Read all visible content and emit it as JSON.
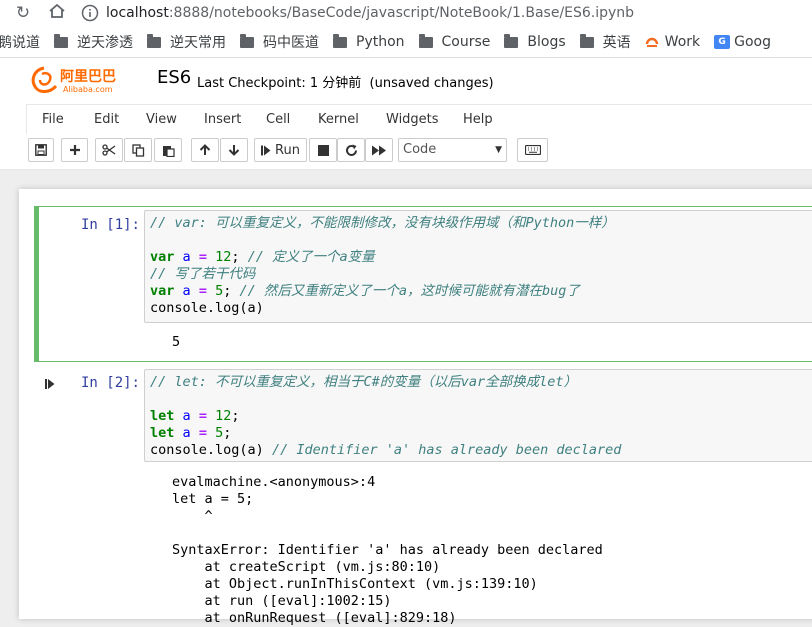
{
  "browser": {
    "url_host": "localhost",
    "url_rest": ":8888/notebooks/BaseCode/javascript/NoteBook/1.Base/ES6.ipynb",
    "back_icon": "arrow-left-icon",
    "reload_icon": "reload-icon",
    "home_icon": "home-icon"
  },
  "bookmarks": [
    {
      "label": "鹅说道",
      "icon": "none"
    },
    {
      "label": "逆天渗透",
      "icon": "folder-icon"
    },
    {
      "label": "逆天常用",
      "icon": "folder-icon"
    },
    {
      "label": "码中医道",
      "icon": "folder-icon"
    },
    {
      "label": "Python",
      "icon": "folder-icon"
    },
    {
      "label": "Course",
      "icon": "folder-icon"
    },
    {
      "label": "Blogs",
      "icon": "folder-icon"
    },
    {
      "label": "英语",
      "icon": "folder-icon"
    },
    {
      "label": "Work",
      "icon": "work-icon"
    },
    {
      "label": "Goog",
      "icon": "google-translate-icon"
    }
  ],
  "header": {
    "logo_text": "阿里巴巴",
    "logo_sub": "Alibaba.com",
    "notebook_title": "ES6",
    "checkpoint": "Last Checkpoint: 1 分钟前",
    "unsaved": "(unsaved changes)"
  },
  "menu": [
    "File",
    "Edit",
    "View",
    "Insert",
    "Cell",
    "Kernel",
    "Widgets",
    "Help"
  ],
  "toolbar": {
    "run_label": "Run",
    "cell_type": "Code"
  },
  "cells": [
    {
      "prompt": "In [1]:",
      "output": [
        "5"
      ]
    },
    {
      "prompt": "In [2]:",
      "output": [
        "evalmachine.<anonymous>:4",
        "let a = 5;",
        "    ^",
        "",
        "SyntaxError: Identifier 'a' has already been declared",
        "    at createScript (vm.js:80:10)",
        "    at Object.runInThisContext (vm.js:139:10)",
        "    at run ([eval]:1002:15)",
        "    at onRunRequest ([eval]:829:18)"
      ]
    }
  ],
  "code": {
    "c1_l1": "// var: 可以重复定义，不能限制修改，没有块级作用域（和Python一样）",
    "c1_l3_kw": "var",
    "c1_l3_var": "a",
    "c1_l3_op": "=",
    "c1_l3_num": "12",
    "c1_l3_com": "// 定义了一个a变量",
    "c1_l4": "// 写了若干代码",
    "c1_l5_kw": "var",
    "c1_l5_var": "a",
    "c1_l5_op": "=",
    "c1_l5_num": "5",
    "c1_l5_com": "// 然后又重新定义了一个a，这时候可能就有潜在bug了",
    "c1_l6": "console.log(a)",
    "c2_l1": "// let: 不可以重复定义，相当于C#的变量（以后var全部换成let）",
    "c2_l3_kw": "let",
    "c2_l3_var": "a",
    "c2_l3_op": "=",
    "c2_l3_num": "12",
    "c2_l4_kw": "let",
    "c2_l4_var": "a",
    "c2_l4_op": "=",
    "c2_l4_num": "5",
    "c2_l5_code": "console.log(a)",
    "c2_l5_com": "// Identifier 'a' has already been declared"
  }
}
